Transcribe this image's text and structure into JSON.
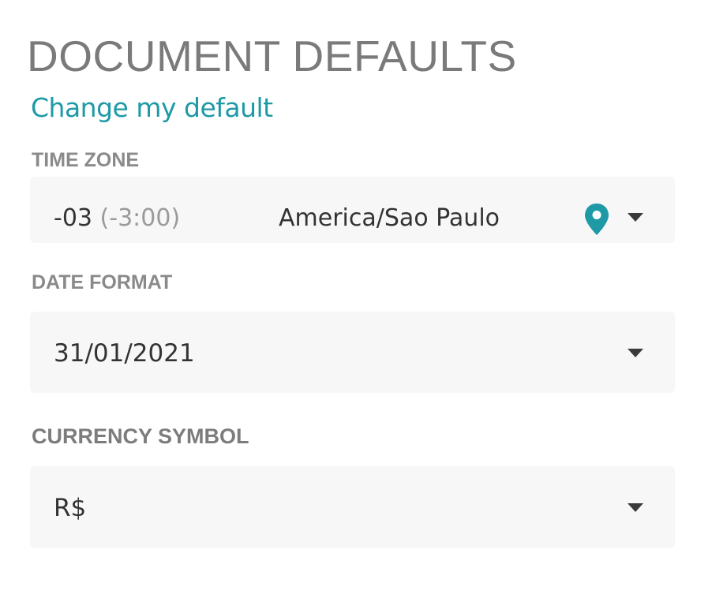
{
  "section": {
    "title": "DOCUMENT DEFAULTS",
    "change_link": "Change my default"
  },
  "time_zone": {
    "label": "TIME ZONE",
    "offset": "-03",
    "offset_detail": "(-3:00)",
    "name": "America/Sao Paulo",
    "pin_icon": "location-pin-icon",
    "pin_color": "#1e9aa6"
  },
  "date_format": {
    "label": "DATE FORMAT",
    "value": "31/01/2021"
  },
  "currency_symbol": {
    "label": "CURRENCY SYMBOL",
    "value": "R$"
  },
  "colors": {
    "accent": "#1e9aa6",
    "title": "#7a7a7a",
    "label": "#8a8a8a",
    "field_bg": "#f7f7f7"
  }
}
